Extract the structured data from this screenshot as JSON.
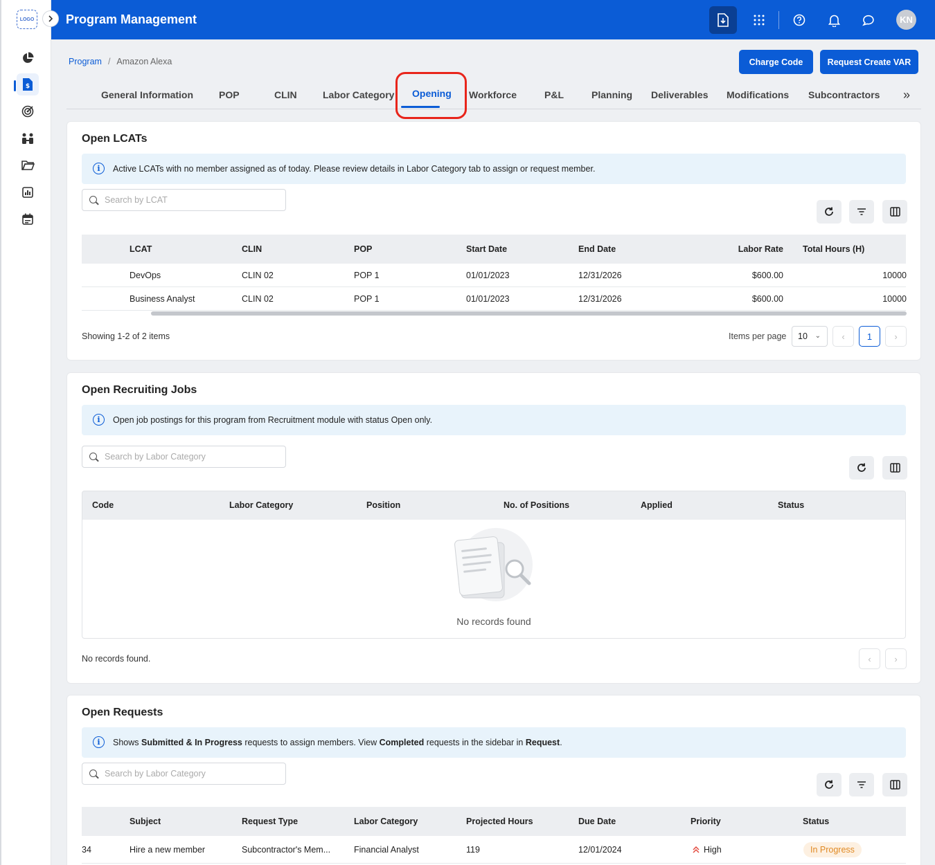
{
  "logo_text": "LOGO",
  "app": {
    "title": "Program Management",
    "user_initials": "KN"
  },
  "icons": {
    "rail": [
      "pie-chart-icon",
      "dollar-document-icon",
      "target-icon",
      "team-icon",
      "folder-open-icon",
      "bar-chart-icon",
      "calendar-icon"
    ],
    "topbar": [
      "download-document-icon",
      "apps-grid-icon",
      "help-icon",
      "bell-icon",
      "chat-icon"
    ]
  },
  "breadcrumb": {
    "root": "Program",
    "separator": "/",
    "current": "Amazon Alexa"
  },
  "header_buttons": {
    "charge_code": "Charge Code",
    "request_var": "Request Create VAR"
  },
  "tabs": [
    "General Information",
    "POP",
    "CLIN",
    "Labor Category",
    "Opening",
    "Workforce",
    "P&L",
    "Planning",
    "Deliverables",
    "Modifications",
    "Subcontractors"
  ],
  "active_tab": "Opening",
  "colors": {
    "brand": "#0b5cd6",
    "highlight": "#e8251b",
    "in_progress": "#e08a24",
    "priority_high": "#e34b3f"
  },
  "open_lcats": {
    "title": "Open LCATs",
    "info": "Active LCATs with no member assigned as of today. Please review details in Labor Category tab to assign or request member.",
    "search_placeholder": "Search by LCAT",
    "columns": [
      "LCAT",
      "CLIN",
      "POP",
      "Start Date",
      "End Date",
      "Labor Rate",
      "Total Hours (H)"
    ],
    "rows": [
      [
        "DevOps",
        "CLIN 02",
        "POP 1",
        "01/01/2023",
        "12/31/2026",
        "$600.00",
        "10000"
      ],
      [
        "Business Analyst",
        "CLIN 02",
        "POP 1",
        "01/01/2023",
        "12/31/2026",
        "$600.00",
        "10000"
      ]
    ],
    "showing": "Showing 1-2 of 2 items",
    "items_per_page_label": "Items per page",
    "items_per_page": "10",
    "current_page": "1"
  },
  "open_jobs": {
    "title": "Open Recruiting Jobs",
    "info": "Open job postings for this program from Recruitment module with status Open only.",
    "search_placeholder": "Search by Labor Category",
    "columns": [
      "Code",
      "Labor Category",
      "Position",
      "No. of Positions",
      "Applied",
      "Status"
    ],
    "empty_message": "No records found",
    "footer": "No records found."
  },
  "open_requests": {
    "title": "Open Requests",
    "info_parts": [
      "Shows ",
      "Submitted & In Progress",
      " requests to assign members. View ",
      "Completed",
      " requests in the sidebar in ",
      "Request",
      "."
    ],
    "search_placeholder": "Search by Labor Category",
    "columns": [
      "Subject",
      "Request Type",
      "Labor Category",
      "Projected Hours",
      "Due Date",
      "Priority",
      "Status"
    ],
    "rows": [
      {
        "id_fragment": "34",
        "subject": "Hire a new member",
        "request_type": "Subcontractor's Mem...",
        "labor_category": "Financial Analyst",
        "projected_hours": "119",
        "due_date": "12/01/2024",
        "priority": "High",
        "status": "In Progress"
      }
    ]
  }
}
